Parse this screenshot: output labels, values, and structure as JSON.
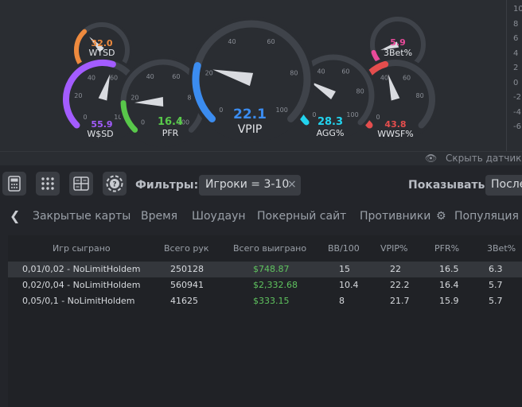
{
  "gauges": [
    {
      "id": "wtsd",
      "label": "WTSD",
      "value": "32.0",
      "color": "#ee8a3e"
    },
    {
      "id": "wsd",
      "label": "W$SD",
      "value": "55.9",
      "color": "#a35cff",
      "ticks": [
        "40",
        "60",
        "20",
        "0",
        "100"
      ]
    },
    {
      "id": "pfr",
      "label": "PFR",
      "value": "16.4",
      "color": "#58c84a",
      "ticks": [
        "40",
        "60",
        "20",
        "80",
        "0",
        "100"
      ]
    },
    {
      "id": "vpip",
      "label": "VPIP",
      "value": "22.1",
      "color": "#3b8cf0",
      "ticks": [
        "40",
        "60",
        "20",
        "80",
        "0",
        "100"
      ]
    },
    {
      "id": "agg",
      "label": "AGG%",
      "value": "28.3",
      "color": "#22d3ee",
      "ticks": [
        "40",
        "60",
        "20",
        "80",
        "0",
        "100"
      ]
    },
    {
      "id": "bet3",
      "label": "3Bet%",
      "value": "5.9",
      "color": "#e84a9a"
    },
    {
      "id": "wwsf",
      "label": "WWSF%",
      "value": "43.8",
      "color": "#e44d4d",
      "ticks": [
        "40",
        "60",
        "20",
        "80",
        "0"
      ]
    }
  ],
  "side_axis_ticks": [
    "10",
    "8",
    "6",
    "4",
    "2",
    "0",
    "-2",
    "-4",
    "-6"
  ],
  "hide_gauges_label": "Скрыть датчики",
  "toolbar": {
    "filters_label": "Фильтры:",
    "filter_chip": "Игроки = 3-10",
    "filter_chip_close": "×",
    "show_label": "Показывать",
    "show_value": "После"
  },
  "tabs": [
    "Закрытые карты",
    "Время",
    "Шоудаун",
    "Покерный сайт",
    "Противники",
    "Популяция"
  ],
  "table": {
    "headers": [
      "Игр сыграно",
      "Всего рук",
      "Всего выиграно",
      "BB/100",
      "VPIP%",
      "PFR%",
      "3Bet%"
    ],
    "rows": [
      [
        "0,01/0,02 - NoLimitHoldem",
        "250128",
        "$748.87",
        "15",
        "22",
        "16.5",
        "6.3"
      ],
      [
        "0,02/0,04 - NoLimitHoldem",
        "560941",
        "$2,332.68",
        "10.4",
        "22.2",
        "16.4",
        "5.7"
      ],
      [
        "0,05/0,1 - NoLimitHoldem",
        "41625",
        "$333.15",
        "8",
        "21.7",
        "15.9",
        "5.7"
      ]
    ]
  },
  "colors": {
    "background": "#23252a",
    "panel": "#2a2d32",
    "gauge_track": "#3f434a",
    "win_green": "#5fc35f"
  }
}
